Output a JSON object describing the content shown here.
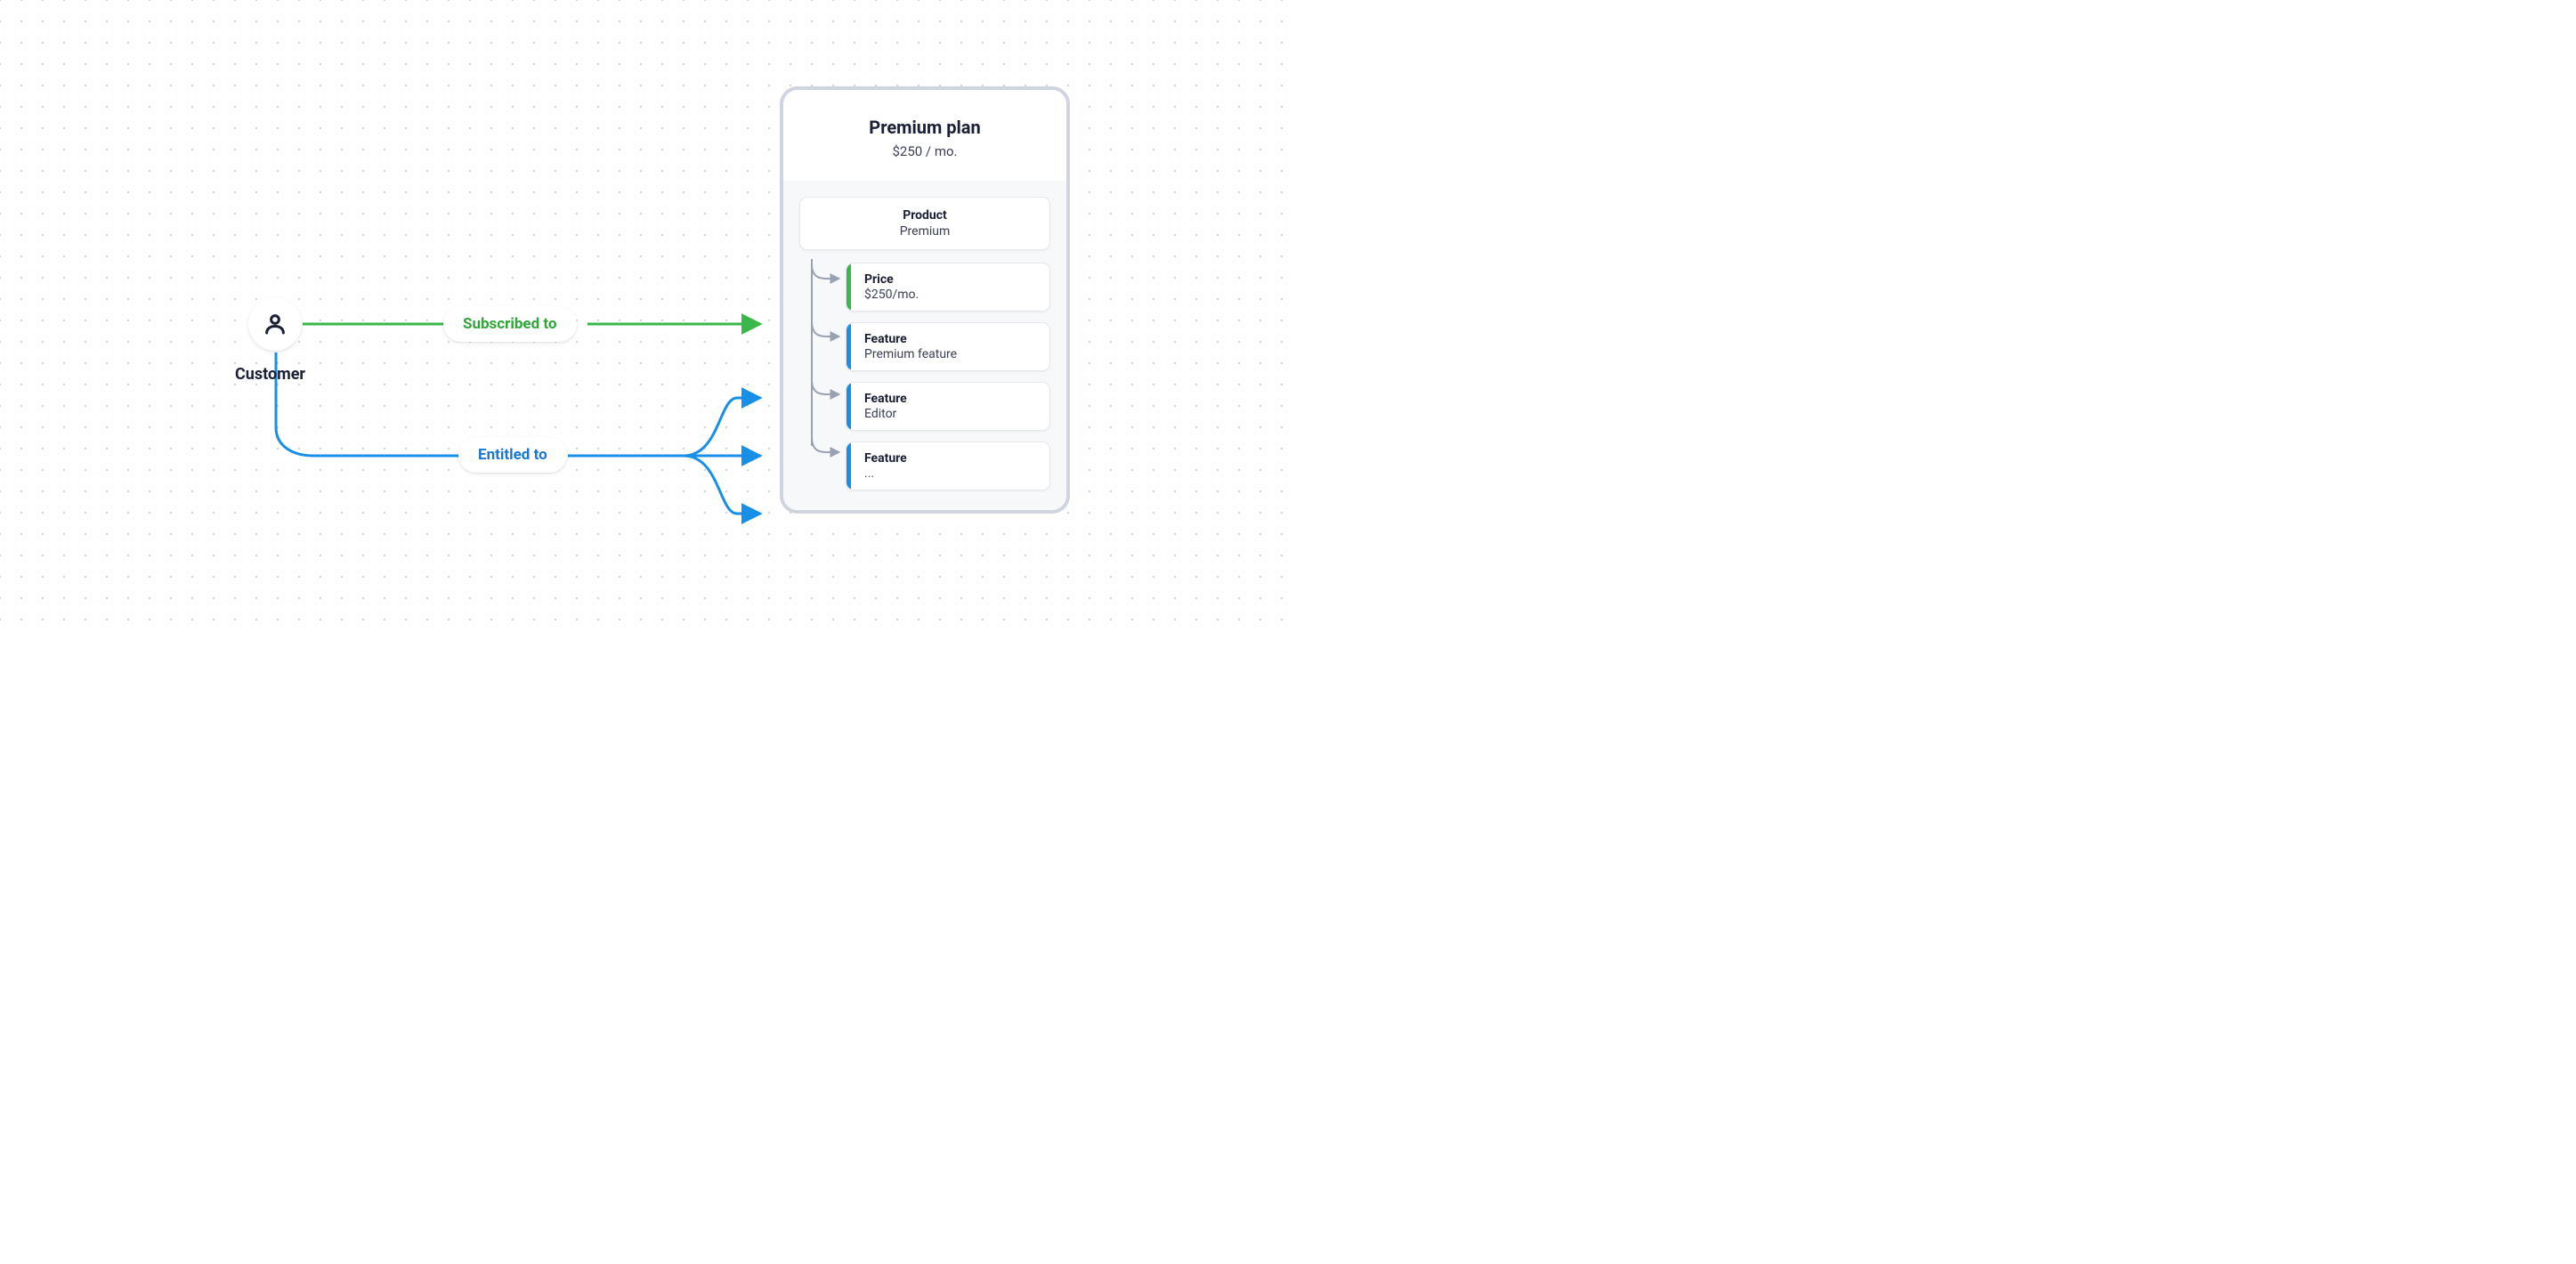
{
  "customer": {
    "label": "Customer"
  },
  "relations": {
    "subscribed": "Subscribed to",
    "entitled": "Entitled to"
  },
  "plan": {
    "title": "Premium plan",
    "price": "$250 / mo.",
    "product": {
      "label": "Product",
      "name": "Premium"
    },
    "items": [
      {
        "label": "Price",
        "value": "$250/mo.",
        "accent": "green"
      },
      {
        "label": "Feature",
        "value": "Premium feature",
        "accent": "blue"
      },
      {
        "label": "Feature",
        "value": "Editor",
        "accent": "blue"
      },
      {
        "label": "Feature",
        "value": "...",
        "accent": "blue"
      }
    ]
  },
  "colors": {
    "green": "#3ab74a",
    "blue": "#188fe6",
    "grey": "#9aa2b1"
  }
}
